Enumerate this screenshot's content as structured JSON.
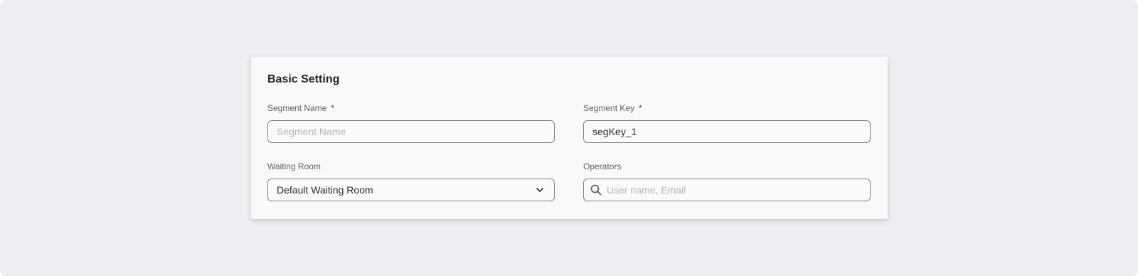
{
  "section": {
    "title": "Basic Setting"
  },
  "fields": {
    "segment_name": {
      "label": "Segment Name",
      "required_mark": "*",
      "value": "",
      "placeholder": "Segment Name"
    },
    "segment_key": {
      "label": "Segment Key",
      "required_mark": "*",
      "value": "segKey_1",
      "placeholder": ""
    },
    "waiting_room": {
      "label": "Waiting Room",
      "selected": "Default Waiting Room",
      "icon": "chevron-down-icon"
    },
    "operators": {
      "label": "Operators",
      "value": "",
      "placeholder": "User name, Email",
      "icon": "search-icon"
    }
  },
  "colors": {
    "background": "#edeef1",
    "card": "#f9f9f9",
    "border": "#808389",
    "placeholder": "#b5b7bc",
    "text": "#2a2c30"
  }
}
